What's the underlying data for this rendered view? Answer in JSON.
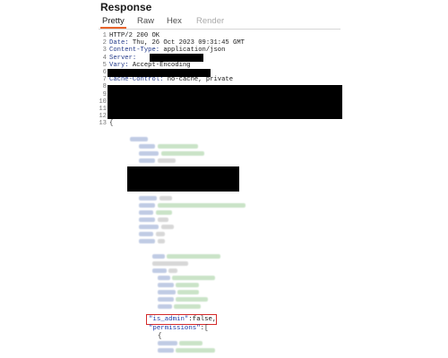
{
  "panel": {
    "title": "Response"
  },
  "tabs": [
    {
      "label": "Pretty",
      "active": true
    },
    {
      "label": "Raw"
    },
    {
      "label": "Hex"
    },
    {
      "label": "Render",
      "disabled": true
    }
  ],
  "accent_color": "#e8642b",
  "headers": [
    {
      "n": "1",
      "text": "HTTP/2 200 OK"
    },
    {
      "n": "2",
      "key": "Date:",
      "value": " Thu, 26 Oct 2023 09:31:45 GMT"
    },
    {
      "n": "3",
      "key": "Content-Type:",
      "value": " application/json"
    },
    {
      "n": "4",
      "key": "Server:",
      "value": ""
    },
    {
      "n": "5",
      "key": "Vary:",
      "value": " Accept-Encoding"
    },
    {
      "n": "6",
      "text": ""
    },
    {
      "n": "7",
      "key": "Cache-Control:",
      "value": " no-cache, private"
    },
    {
      "n": "8",
      "text": ""
    },
    {
      "n": "9",
      "text": ""
    },
    {
      "n": "10",
      "text": ""
    },
    {
      "n": "11",
      "text": ""
    },
    {
      "n": "12",
      "text": ""
    },
    {
      "n": "13",
      "text": "{"
    }
  ],
  "body_visible": {
    "is_admin_key": "\"is_admin\"",
    "is_admin_value": ":false,",
    "permissions_key": "\"permissions\"",
    "permissions_value": ":[",
    "open_brace": "{"
  }
}
